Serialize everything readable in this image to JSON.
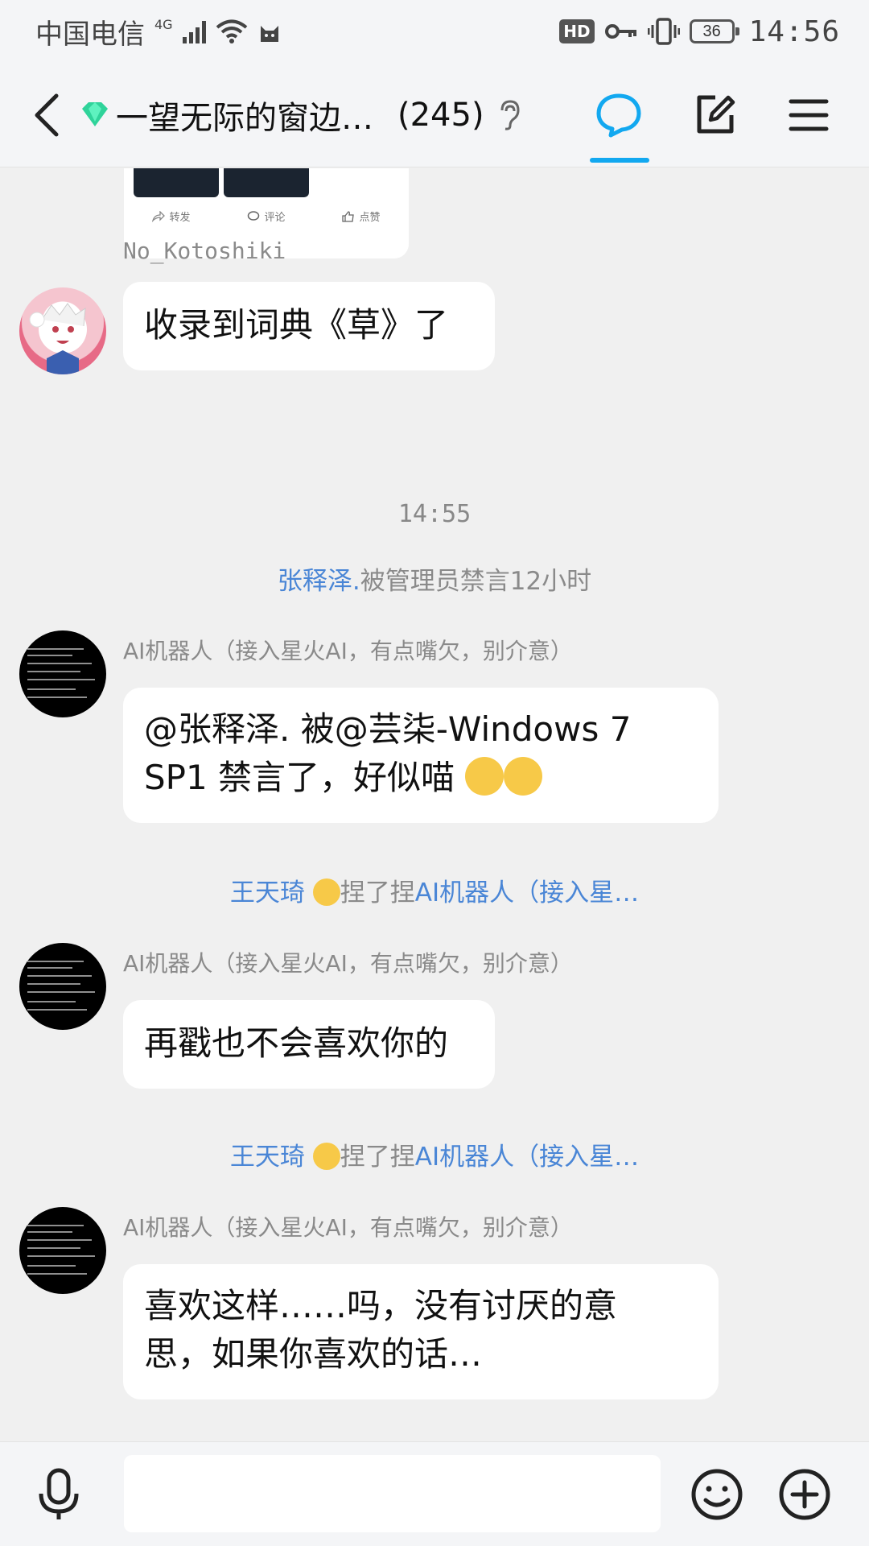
{
  "status_bar": {
    "carrier": "中国电信",
    "network": "4G",
    "hd": "HD",
    "battery": "36",
    "time": "14:56"
  },
  "header": {
    "title": "一望无际的窗边…",
    "member_count": "(245)"
  },
  "shared_card": {
    "repost": "转发",
    "comment": "评论",
    "like": "点赞"
  },
  "messages": [
    {
      "sender": "No_Kotoshiki",
      "text": "收录到词典《草》了"
    },
    {
      "timestamp": "14:55"
    },
    {
      "system": {
        "user": "张释泽.",
        "action": "被管理员禁言12小时"
      }
    },
    {
      "sender": "AI机器人（接入星火AI，有点嘴欠，别介意）",
      "text_line1": "@张释泽. 被@芸柒-Windows 7",
      "text_line2": "SP1 禁言了，好似喵"
    },
    {
      "system": {
        "user": "王天琦",
        "action": "捏了捏",
        "target": "AI机器人（接入星…"
      }
    },
    {
      "sender": "AI机器人（接入星火AI，有点嘴欠，别介意）",
      "text": "再戳也不会喜欢你的"
    },
    {
      "system": {
        "user": "王天琦",
        "action": "捏了捏",
        "target": "AI机器人（接入星…"
      }
    },
    {
      "sender": "AI机器人（接入星火AI，有点嘴欠，别介意）",
      "text_line1": "喜欢这样……吗，没有讨厌的意",
      "text_line2": "思，如果你喜欢的话…"
    }
  ],
  "colors": {
    "accent": "#12a8f0",
    "mention_blue": "#4a86d6",
    "background": "#f0f0f0"
  },
  "icons": [
    "back-icon",
    "ear-icon",
    "chat-icon",
    "edit-icon",
    "menu-icon",
    "mic-icon",
    "emoji-icon",
    "plus-icon"
  ]
}
